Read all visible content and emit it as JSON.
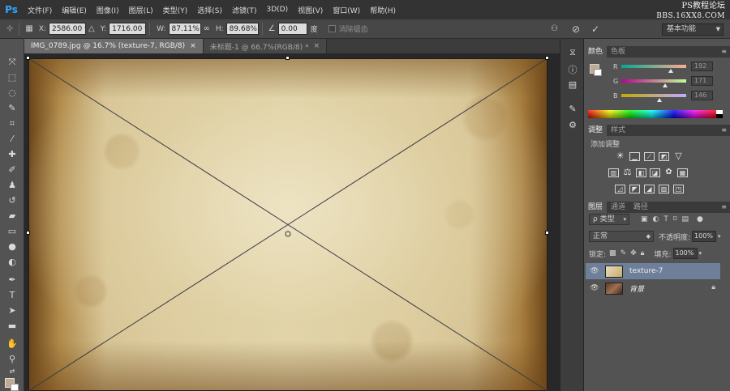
{
  "app": {
    "logo": "Ps"
  },
  "menu": [
    "文件(F)",
    "编辑(E)",
    "图像(I)",
    "图层(L)",
    "类型(Y)",
    "选择(S)",
    "滤镜(T)",
    "3D(D)",
    "视图(V)",
    "窗口(W)",
    "帮助(H)"
  ],
  "watermark": {
    "line1": "PS教程论坛",
    "line2": "BBS.16XX8.COM"
  },
  "options": {
    "x_label": "X:",
    "x_value": "2586.00 像",
    "y_label": "Y:",
    "y_value": "1716.00 像",
    "w_label": "W:",
    "w_value": "87.11%",
    "h_label": "H:",
    "h_value": "89.68%",
    "angle_value": "0.00",
    "angle_unit": "度",
    "antialias_label": "消除锯齿",
    "workspace": "基本功能"
  },
  "tabs": [
    {
      "label": "IMG_0789.jpg @ 16.7% (texture-7, RGB/8)",
      "close": "×"
    },
    {
      "label": "未标题-1 @ 66.7%(RGB/8) *",
      "close": "×"
    }
  ],
  "color_panel": {
    "tabs": [
      "颜色",
      "色板"
    ],
    "r_label": "R",
    "r_value": "192",
    "g_label": "G",
    "g_value": "171",
    "b_label": "B",
    "b_value": "146",
    "fg_color": "#c0ab92",
    "bg_color": "#ffffff"
  },
  "adjustments_panel": {
    "tabs": [
      "调整",
      "样式"
    ],
    "title": "添加调整"
  },
  "layers_panel": {
    "tabs": [
      "图层",
      "通道",
      "路径"
    ],
    "filter_kind": "ρ 类型",
    "blend_mode": "正常",
    "opacity_label": "不透明度:",
    "opacity_value": "100%",
    "lock_label": "锁定:",
    "fill_label": "填充:",
    "fill_value": "100%",
    "layers": [
      {
        "name": "texture-7",
        "selected": true
      },
      {
        "name": "背景",
        "selected": false,
        "locked": true
      }
    ]
  },
  "colors": {
    "menubar": "#333333",
    "panel": "#535353",
    "selection": "#6d7f99",
    "accent": "#31a8ff"
  }
}
